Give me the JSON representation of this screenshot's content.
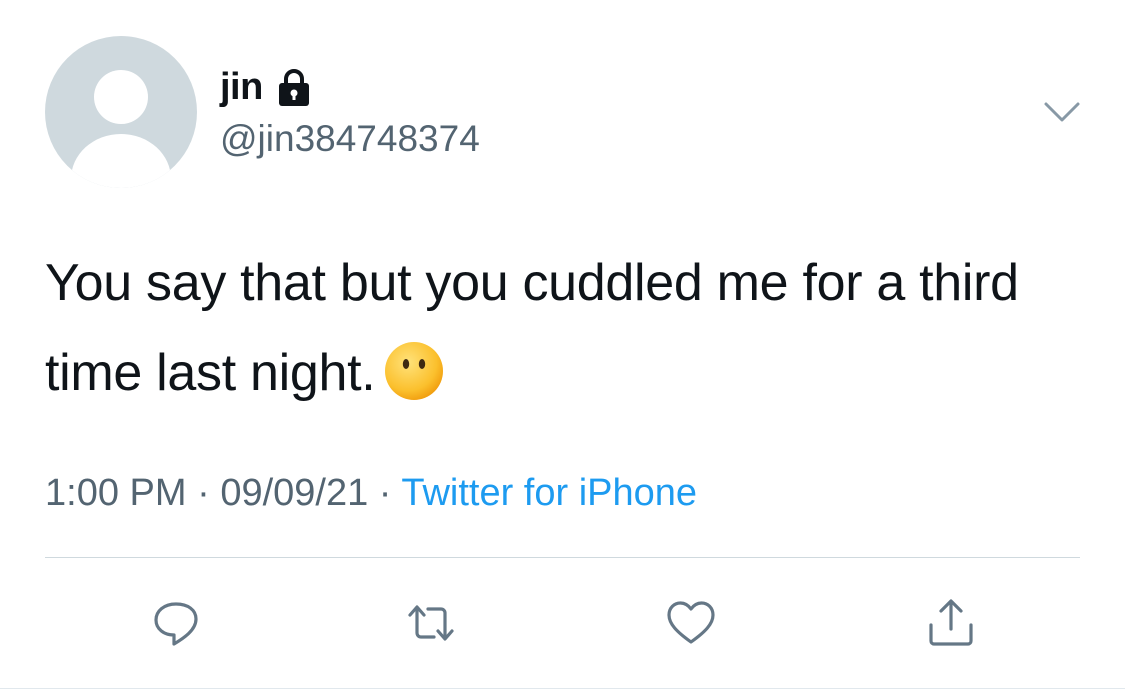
{
  "author": {
    "display_name": "jin",
    "handle": "@jin384748374",
    "protected_icon": "lock-icon",
    "avatar": "default-avatar"
  },
  "tweet": {
    "text": "You say that but you cuddled me for a third time last night.",
    "emoji": "face-without-mouth"
  },
  "meta": {
    "time": "1:00 PM",
    "separator1": " · ",
    "date": "09/09/21",
    "separator2": " · ",
    "source": "Twitter for iPhone"
  },
  "actions": [
    {
      "icon": "reply-icon"
    },
    {
      "icon": "retweet-icon"
    },
    {
      "icon": "like-icon"
    },
    {
      "icon": "share-icon"
    }
  ],
  "colors": {
    "text": "#0f1419",
    "secondary": "#536471",
    "link": "#1d9bf0",
    "divider": "#cfd9de"
  }
}
